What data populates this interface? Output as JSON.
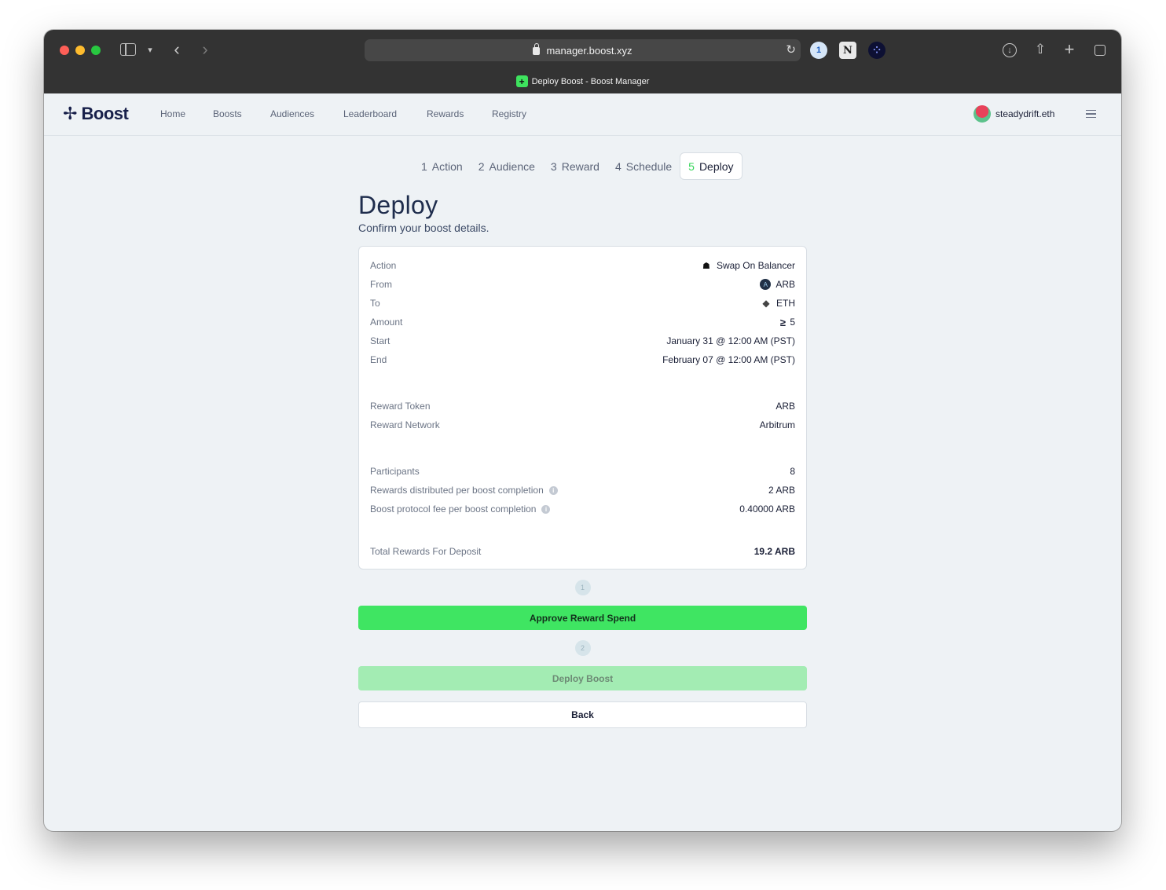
{
  "browser": {
    "url": "manager.boost.xyz",
    "tab_title": "Deploy Boost - Boost Manager"
  },
  "site": {
    "logo": "Boost",
    "nav": [
      "Home",
      "Boosts",
      "Audiences",
      "Leaderboard",
      "Rewards",
      "Registry"
    ],
    "user": "steadydrift.eth"
  },
  "steps": [
    {
      "num": "1",
      "label": "Action"
    },
    {
      "num": "2",
      "label": "Audience"
    },
    {
      "num": "3",
      "label": "Reward"
    },
    {
      "num": "4",
      "label": "Schedule"
    },
    {
      "num": "5",
      "label": "Deploy",
      "active": true
    }
  ],
  "page": {
    "title": "Deploy",
    "subtitle": "Confirm your boost details."
  },
  "details": {
    "action": {
      "label": "Action",
      "value": "Swap On Balancer"
    },
    "from": {
      "label": "From",
      "value": "ARB"
    },
    "to": {
      "label": "To",
      "value": "ETH"
    },
    "amount": {
      "label": "Amount",
      "prefix": "≥",
      "value": "5"
    },
    "start": {
      "label": "Start",
      "value": "January 31 @ 12:00 AM (PST)"
    },
    "end": {
      "label": "End",
      "value": "February 07 @ 12:00 AM (PST)"
    },
    "reward_token": {
      "label": "Reward Token",
      "value": "ARB"
    },
    "reward_network": {
      "label": "Reward Network",
      "value": "Arbitrum"
    },
    "participants": {
      "label": "Participants",
      "value": "8"
    },
    "rewards_per_completion": {
      "label": "Rewards distributed per boost completion",
      "value": "2 ARB"
    },
    "fee_per_completion": {
      "label": "Boost protocol fee per boost completion",
      "value": "0.40000 ARB"
    },
    "total": {
      "label": "Total Rewards For Deposit",
      "value": "19.2 ARB"
    }
  },
  "actions": {
    "step1": "1",
    "approve_label": "Approve Reward Spend",
    "step2": "2",
    "deploy_label": "Deploy Boost",
    "back_label": "Back"
  },
  "colors": {
    "accent_green": "#3fe562",
    "disabled_green": "#a3ecb3",
    "navy": "#1f2d4d"
  }
}
